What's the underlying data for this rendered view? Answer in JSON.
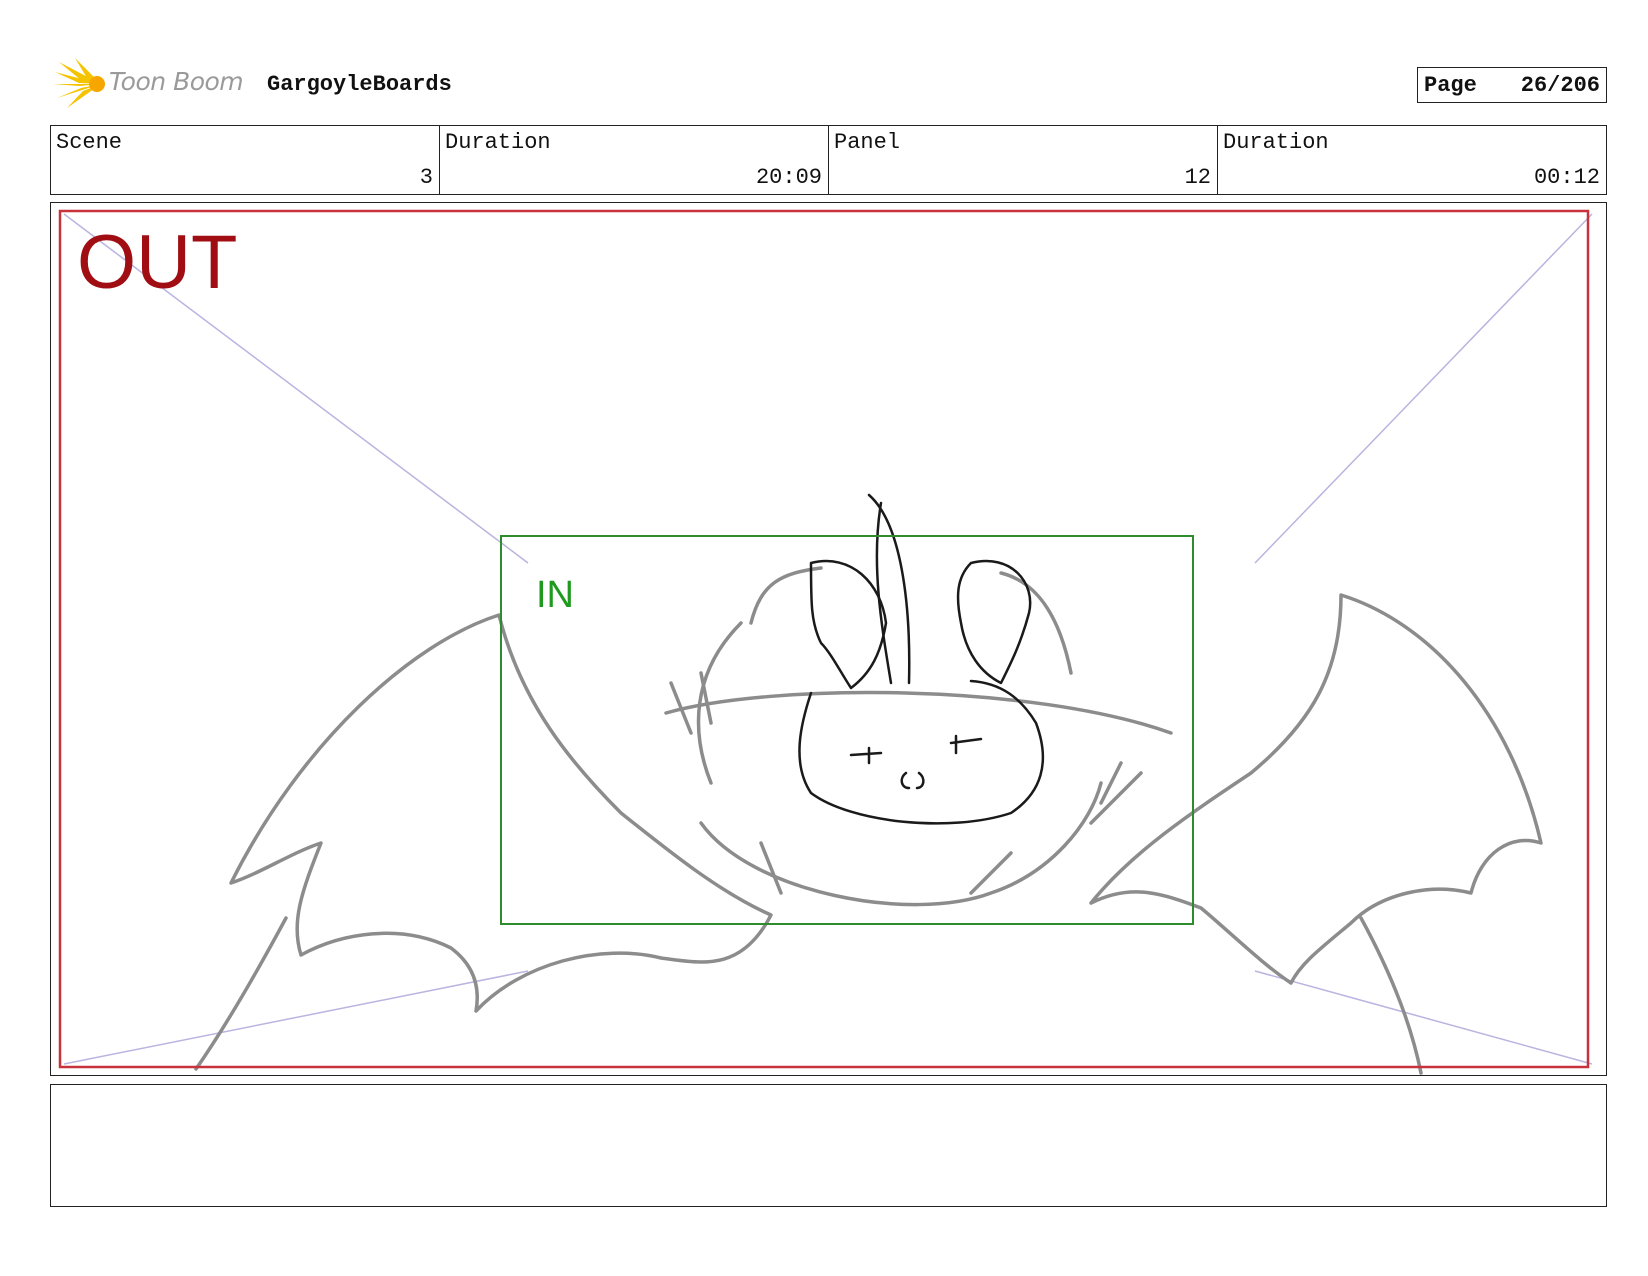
{
  "header": {
    "logo_text": "Toon Boom",
    "project_title": "GargoyleBoards",
    "page_label": "Page",
    "page_number": "26/206",
    "logo_icon": "starburst-icon"
  },
  "info": {
    "scene_label": "Scene",
    "scene_value": "3",
    "scene_duration_label": "Duration",
    "scene_duration_value": "20:09",
    "panel_label": "Panel",
    "panel_value": "12",
    "panel_duration_label": "Duration",
    "panel_duration_value": "00:12"
  },
  "panel": {
    "out_label": "OUT",
    "in_label": "IN",
    "colors": {
      "out_frame": "#c8323c",
      "in_frame": "#2e8b2e",
      "guide_lines": "#b9b4e0",
      "sketch_light": "#8c8c8c",
      "sketch_dark": "#1a1a1a"
    }
  },
  "notes": {
    "text": ""
  }
}
